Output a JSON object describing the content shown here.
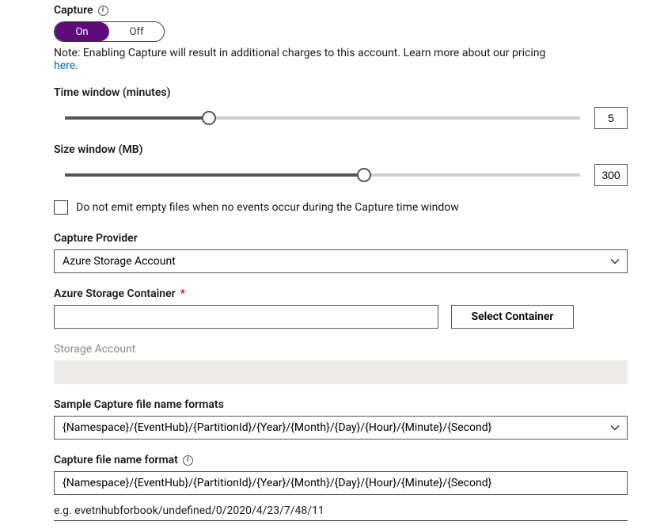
{
  "capture": {
    "label": "Capture",
    "toggle": {
      "on_label": "On",
      "off_label": "Off",
      "value": "On"
    },
    "note_prefix": "Note: Enabling Capture will result in additional charges to this account. Learn more about our pricing ",
    "note_link": "here."
  },
  "time_window": {
    "label": "Time window (minutes)",
    "value": "5",
    "fill_pct": "28%"
  },
  "size_window": {
    "label": "Size window (MB)",
    "value": "300",
    "fill_pct": "58%"
  },
  "checkbox": {
    "label": "Do not emit empty files when no events occur during the Capture time window",
    "checked": false
  },
  "provider": {
    "label": "Capture Provider",
    "value": "Azure Storage Account"
  },
  "container": {
    "label": "Azure Storage Container",
    "value": "",
    "button": "Select Container"
  },
  "storage_account": {
    "label": "Storage Account"
  },
  "sample_formats": {
    "label": "Sample Capture file name formats",
    "value": "{Namespace}/{EventHub}/{PartitionId}/{Year}/{Month}/{Day}/{Hour}/{Minute}/{Second}"
  },
  "file_format": {
    "label": "Capture file name format",
    "value": "{Namespace}/{EventHub}/{PartitionId}/{Year}/{Month}/{Day}/{Hour}/{Minute}/{Second}",
    "example": "e.g. evetnhubforbook/undefined/0/2020/4/23/7/48/11"
  }
}
